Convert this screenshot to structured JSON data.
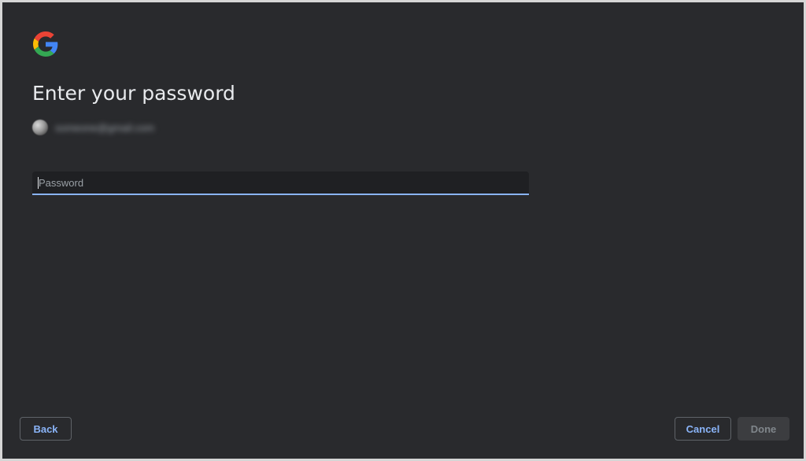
{
  "header": {
    "logo_icon": "google-g-logo",
    "title": "Enter your password"
  },
  "account": {
    "avatar_icon": "user-avatar",
    "email": "someone@gmail.com"
  },
  "password_field": {
    "placeholder": "Password",
    "value": ""
  },
  "footer": {
    "back_label": "Back",
    "cancel_label": "Cancel",
    "done_label": "Done"
  },
  "colors": {
    "background": "#292a2d",
    "accent": "#8ab4f8",
    "text": "#e8eaed",
    "disabled_button_bg": "#3c3d40",
    "disabled_button_text": "#80868b"
  }
}
